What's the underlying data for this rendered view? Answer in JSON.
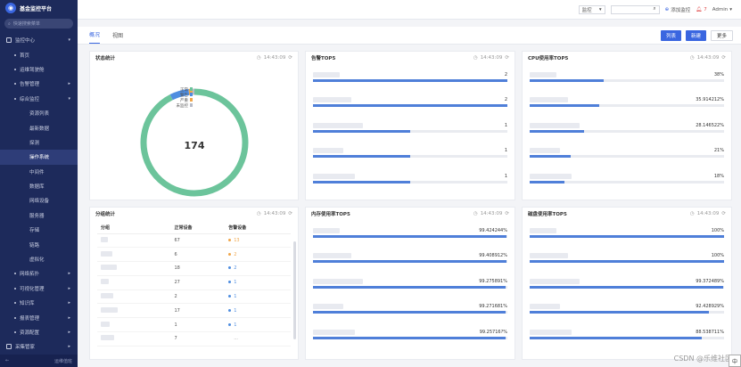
{
  "app": {
    "title": "基金监控平台",
    "search_placeholder": "快速搜索菜单"
  },
  "sidebar": {
    "items": [
      {
        "label": "监控中心",
        "level": 0,
        "caret": "▾"
      },
      {
        "label": "首页",
        "level": 1
      },
      {
        "label": "运维驾驶舱",
        "level": 1
      },
      {
        "label": "告警管理",
        "level": 1,
        "caret": "▸"
      },
      {
        "label": "综合监控",
        "level": 1,
        "caret": "▾"
      },
      {
        "label": "资源列表",
        "level": 2
      },
      {
        "label": "最新数据",
        "level": 2
      },
      {
        "label": "探测",
        "level": 2
      },
      {
        "label": "操作系统",
        "level": 2,
        "active": true
      },
      {
        "label": "中间件",
        "level": 2
      },
      {
        "label": "数据库",
        "level": 2
      },
      {
        "label": "网络设备",
        "level": 2
      },
      {
        "label": "服务器",
        "level": 2
      },
      {
        "label": "存储",
        "level": 2
      },
      {
        "label": "链路",
        "level": 2
      },
      {
        "label": "虚拟化",
        "level": 2
      },
      {
        "label": "网络拓扑",
        "level": 1,
        "caret": "▸"
      },
      {
        "label": "可视化管理",
        "level": 1,
        "caret": "▸"
      },
      {
        "label": "知识库",
        "level": 1,
        "caret": "▸"
      },
      {
        "label": "报表管理",
        "level": 1,
        "caret": "▸"
      },
      {
        "label": "资源配置",
        "level": 1,
        "caret": "▸"
      },
      {
        "label": "采集管家",
        "level": 0,
        "caret": "▸"
      }
    ],
    "bottom_label": "运维值班"
  },
  "topbar": {
    "select_value": "监控",
    "add_monitor": "添加监控",
    "alert_count": "7",
    "user": "Admin"
  },
  "tabs": [
    {
      "label": "概况",
      "active": true
    },
    {
      "label": "视图",
      "active": false
    }
  ],
  "actions": {
    "list": "列表",
    "new": "新建",
    "more": "更多"
  },
  "time": "14:43:09",
  "status_card": {
    "title": "状态统计",
    "total": "174",
    "legend": [
      {
        "label": "正常",
        "color": "#6cc49b"
      },
      {
        "label": "警告",
        "color": "#4f8de0"
      },
      {
        "label": "严重",
        "color": "#f0a64a"
      },
      {
        "label": "未监控",
        "color": "#b8bcc8"
      }
    ],
    "chart_data": {
      "type": "pie",
      "values": [
        161,
        10,
        2,
        1
      ],
      "colors": [
        "#6cc49b",
        "#4f8de0",
        "#f0a64a",
        "#b8bcc8"
      ]
    }
  },
  "alarm_top5": {
    "title": "告警TOP5",
    "rows": [
      {
        "value": "2",
        "pct": 1.0
      },
      {
        "value": "2",
        "pct": 1.0
      },
      {
        "value": "1",
        "pct": 0.5
      },
      {
        "value": "1",
        "pct": 0.5
      },
      {
        "value": "1",
        "pct": 0.5
      }
    ]
  },
  "cpu_top5": {
    "title": "CPU使用率TOP5",
    "rows": [
      {
        "value": "38%",
        "pct": 0.38
      },
      {
        "value": "35.914212%",
        "pct": 0.359
      },
      {
        "value": "28.146522%",
        "pct": 0.281
      },
      {
        "value": "21%",
        "pct": 0.21
      },
      {
        "value": "18%",
        "pct": 0.18
      }
    ]
  },
  "group_card": {
    "title": "分组统计",
    "headers": [
      "分组",
      "正常设备",
      "告警设备"
    ],
    "rows": [
      {
        "normal": "67",
        "alarm": "13",
        "alarm_color": "#f0a64a"
      },
      {
        "normal": "6",
        "alarm": "2",
        "alarm_color": "#f0a64a"
      },
      {
        "normal": "18",
        "alarm": "2",
        "alarm_color": "#4f8de0"
      },
      {
        "normal": "27",
        "alarm": "1",
        "alarm_color": "#4f8de0"
      },
      {
        "normal": "2",
        "alarm": "1",
        "alarm_color": "#4f8de0"
      },
      {
        "normal": "17",
        "alarm": "1",
        "alarm_color": "#4f8de0"
      },
      {
        "normal": "1",
        "alarm": "1",
        "alarm_color": "#4f8de0"
      },
      {
        "normal": "7",
        "alarm": "...",
        "alarm_color": "#ffffff"
      }
    ]
  },
  "mem_top5": {
    "title": "内存使用率TOP5",
    "rows": [
      {
        "value": "99.424244%",
        "pct": 0.994
      },
      {
        "value": "99.408912%",
        "pct": 0.994
      },
      {
        "value": "99.275891%",
        "pct": 0.993
      },
      {
        "value": "99.271681%",
        "pct": 0.993
      },
      {
        "value": "99.25716?%",
        "pct": 0.993
      }
    ]
  },
  "disk_top5": {
    "title": "磁盘使用率TOP5",
    "rows": [
      {
        "value": "100%",
        "pct": 1.0
      },
      {
        "value": "100%",
        "pct": 1.0
      },
      {
        "value": "99.372489%",
        "pct": 0.994
      },
      {
        "value": "92.428929%",
        "pct": 0.924
      },
      {
        "value": "88.538711%",
        "pct": 0.885
      }
    ]
  },
  "watermark": "CSDN @乐维社区",
  "ime": "中"
}
